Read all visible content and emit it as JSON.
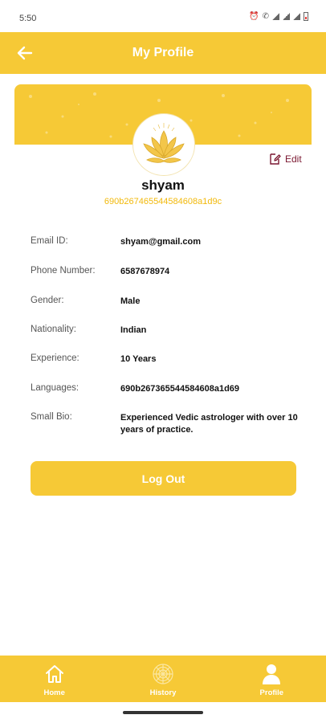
{
  "status_bar": {
    "time": "5:50"
  },
  "app_bar": {
    "title": "My Profile"
  },
  "profile": {
    "name": "shyam",
    "id": "690b267465544584608a1d9c",
    "edit_label": "Edit"
  },
  "details": [
    {
      "label": "Email ID:",
      "value": "shyam@gmail.com"
    },
    {
      "label": "Phone Number:",
      "value": "6587678974"
    },
    {
      "label": "Gender:",
      "value": "Male"
    },
    {
      "label": "Nationality:",
      "value": "Indian"
    },
    {
      "label": "Experience:",
      "value": "10 Years"
    },
    {
      "label": "Languages:",
      "value": "690b267365544584608a1d69"
    },
    {
      "label": "Small Bio:",
      "value": "Experienced Vedic astrologer with over 10 years of practice."
    }
  ],
  "logout_label": "Log Out",
  "bottom_nav": [
    {
      "label": "Home",
      "icon": "home-icon"
    },
    {
      "label": "History",
      "icon": "history-icon"
    },
    {
      "label": "Profile",
      "icon": "profile-icon"
    }
  ],
  "colors": {
    "accent": "#f6c936",
    "id_text": "#f2b90b",
    "edit": "#7a1730"
  }
}
